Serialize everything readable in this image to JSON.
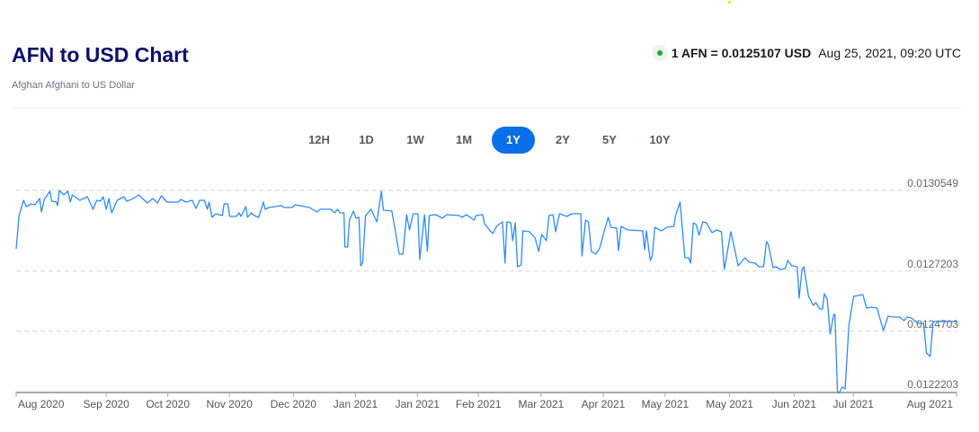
{
  "header": {
    "title": "AFN to USD Chart",
    "subtitle": "Afghan Afghani to US Dollar",
    "rate": "1 AFN = 0.0125107 USD",
    "timestamp": "Aug 25, 2021, 09:20 UTC",
    "live_icon": "green-dot-icon"
  },
  "ranges": [
    {
      "label": "12H",
      "active": false
    },
    {
      "label": "1D",
      "active": false
    },
    {
      "label": "1W",
      "active": false
    },
    {
      "label": "1M",
      "active": false
    },
    {
      "label": "1Y",
      "active": true
    },
    {
      "label": "2Y",
      "active": false
    },
    {
      "label": "5Y",
      "active": false
    },
    {
      "label": "10Y",
      "active": false
    }
  ],
  "colors": {
    "line": "#2f8af5",
    "accent": "#0a6fe8",
    "title": "#0d0f6b",
    "live": "#22a33a"
  },
  "chart_data": {
    "type": "line",
    "title": "AFN to USD Chart",
    "xlabel": "",
    "ylabel": "",
    "xlim": [
      0,
      357.2
    ],
    "ylim": [
      0.0122203,
      0.0130549
    ],
    "grid": true,
    "yticks": [
      {
        "value": 0.0130549,
        "label": "0.0130549"
      },
      {
        "value": 0.0127203,
        "label": "0.0127203"
      },
      {
        "value": 0.0124703,
        "label": "0.0124703"
      },
      {
        "value": 0.0122203,
        "label": "0.0122203"
      }
    ],
    "xticks": [
      {
        "day": 0,
        "label": "Aug 2020"
      },
      {
        "day": 34.2,
        "label": "Sep 2020"
      },
      {
        "day": 57.6,
        "label": "Oct 2020"
      },
      {
        "day": 81.0,
        "label": "Nov 2020"
      },
      {
        "day": 105.3,
        "label": "Dec 2020"
      },
      {
        "day": 128.9,
        "label": "Jan 2021"
      },
      {
        "day": 152.4,
        "label": "Jan 2021"
      },
      {
        "day": 175.6,
        "label": "Feb 2021"
      },
      {
        "day": 199.4,
        "label": "Mar 2021"
      },
      {
        "day": 223.0,
        "label": "Apr 2021"
      },
      {
        "day": 246.5,
        "label": "May 2021"
      },
      {
        "day": 271.0,
        "label": "May 2021"
      },
      {
        "day": 295.5,
        "label": "Jun 2021"
      },
      {
        "day": 318.0,
        "label": "Jul 2021"
      },
      {
        "day": 357.2,
        "label": "Aug 2021"
      }
    ],
    "series": [
      {
        "name": "AFN/USD",
        "points": [
          [
            0,
            0.0128127
          ],
          [
            1.1,
            0.0129506
          ],
          [
            2.8,
            0.0130139
          ],
          [
            3.9,
            0.0129879
          ],
          [
            5.7,
            0.012999
          ],
          [
            7.1,
            0.0129953
          ],
          [
            8.9,
            0.0130214
          ],
          [
            9.6,
            0.0129655
          ],
          [
            10.7,
            0.0130177
          ],
          [
            12.8,
            0.0130512
          ],
          [
            13.5,
            0.0130102
          ],
          [
            15.3,
            0.0130065
          ],
          [
            15.7,
            0.0129916
          ],
          [
            16.4,
            0.0130549
          ],
          [
            18.1,
            0.0130363
          ],
          [
            19.6,
            0.0130512
          ],
          [
            20.6,
            0.0130065
          ],
          [
            21.3,
            0.0130363
          ],
          [
            24.2,
            0.0130139
          ],
          [
            27.0,
            0.0130288
          ],
          [
            29.2,
            0.0129767
          ],
          [
            30.6,
            0.0130139
          ],
          [
            32.0,
            0.0130102
          ],
          [
            33.1,
            0.0130288
          ],
          [
            34.2,
            0.0129767
          ],
          [
            35.2,
            0.0130214
          ],
          [
            36.3,
            0.0129618
          ],
          [
            38.4,
            0.0130139
          ],
          [
            40.9,
            0.0130288
          ],
          [
            42.0,
            0.0130102
          ],
          [
            43.8,
            0.0130177
          ],
          [
            46.6,
            0.0130363
          ],
          [
            49.8,
            0.0130028
          ],
          [
            51.9,
            0.0130214
          ],
          [
            53.7,
            0.0130028
          ],
          [
            55.1,
            0.0130326
          ],
          [
            57.3,
            0.0130065
          ],
          [
            61.5,
            0.0130065
          ],
          [
            62.6,
            0.0130177
          ],
          [
            64.4,
            0.0130065
          ],
          [
            66.9,
            0.0130139
          ],
          [
            68.3,
            0.0129804
          ],
          [
            69.7,
            0.0130139
          ],
          [
            71.5,
            0.0130139
          ],
          [
            72.6,
            0.0129767
          ],
          [
            73.3,
            0.0130065
          ],
          [
            74.4,
            0.0129431
          ],
          [
            75.8,
            0.012958
          ],
          [
            78.3,
            0.0129506
          ],
          [
            79.0,
            0.012999
          ],
          [
            80.4,
            0.012999
          ],
          [
            81.1,
            0.0129469
          ],
          [
            83.6,
            0.0129469
          ],
          [
            84.7,
            0.0129618
          ],
          [
            85.4,
            0.0129469
          ],
          [
            87.2,
            0.0129879
          ],
          [
            87.9,
            0.0129431
          ],
          [
            89.3,
            0.0129618
          ],
          [
            90.4,
            0.0129506
          ],
          [
            92.1,
            0.0129431
          ],
          [
            93.9,
            0.0130065
          ],
          [
            94.6,
            0.0129767
          ],
          [
            96.1,
            0.0129841
          ],
          [
            100.7,
            0.0129916
          ],
          [
            101.7,
            0.0129841
          ],
          [
            104.9,
            0.0129841
          ],
          [
            106.0,
            0.0129953
          ],
          [
            111.4,
            0.0129841
          ],
          [
            114.2,
            0.0129655
          ],
          [
            115.6,
            0.0129767
          ],
          [
            119.5,
            0.0129767
          ],
          [
            121.0,
            0.0129618
          ],
          [
            122.0,
            0.0129767
          ],
          [
            123.1,
            0.0129618
          ],
          [
            124.5,
            0.0129618
          ],
          [
            124.9,
            0.0128202
          ],
          [
            125.9,
            0.0128202
          ],
          [
            126.6,
            0.012932
          ],
          [
            128.1,
            0.0129692
          ],
          [
            129.1,
            0.0129394
          ],
          [
            130.2,
            0.0129431
          ],
          [
            130.9,
            0.0127419
          ],
          [
            131.6,
            0.0127531
          ],
          [
            132.7,
            0.0129506
          ],
          [
            134.8,
            0.0129767
          ],
          [
            137.0,
            0.0129245
          ],
          [
            138.7,
            0.0130512
          ],
          [
            139.5,
            0.012973
          ],
          [
            142.7,
            0.0129692
          ],
          [
            145.5,
            0.0127904
          ],
          [
            146.9,
            0.0127904
          ],
          [
            148.3,
            0.0129543
          ],
          [
            149.4,
            0.012891
          ],
          [
            150.8,
            0.012958
          ],
          [
            152.6,
            0.012958
          ],
          [
            153.3,
            0.012768
          ],
          [
            155.1,
            0.0129543
          ],
          [
            156.2,
            0.0128016
          ],
          [
            156.9,
            0.0129506
          ],
          [
            159.4,
            0.0129543
          ],
          [
            161.9,
            0.0129394
          ],
          [
            163.6,
            0.0129543
          ],
          [
            168.3,
            0.0129506
          ],
          [
            169.3,
            0.0129431
          ],
          [
            171.1,
            0.0129543
          ],
          [
            173.9,
            0.012932
          ],
          [
            174.7,
            0.0129506
          ],
          [
            177.2,
            0.0129543
          ],
          [
            177.9,
            0.0129171
          ],
          [
            180.0,
            0.0128873
          ],
          [
            181.1,
            0.0128761
          ],
          [
            182.5,
            0.0129059
          ],
          [
            184.7,
            0.0129245
          ],
          [
            185.7,
            0.0127531
          ],
          [
            186.4,
            0.0129245
          ],
          [
            187.9,
            0.0129208
          ],
          [
            188.6,
            0.0128463
          ],
          [
            189.6,
            0.0129208
          ],
          [
            190.4,
            0.0127382
          ],
          [
            191.8,
            0.0127457
          ],
          [
            192.5,
            0.0128873
          ],
          [
            195.0,
            0.0128835
          ],
          [
            197.1,
            0.0128574
          ],
          [
            198.5,
            0.0128016
          ],
          [
            199.6,
            0.0128723
          ],
          [
            201.4,
            0.0128463
          ],
          [
            202.4,
            0.0129506
          ],
          [
            203.9,
            0.0129543
          ],
          [
            204.9,
            0.0128835
          ],
          [
            206.4,
            0.012958
          ],
          [
            209.2,
            0.0129469
          ],
          [
            211.0,
            0.012958
          ],
          [
            214.5,
            0.012958
          ],
          [
            214.9,
            0.0127829
          ],
          [
            216.3,
            0.012932
          ],
          [
            217.4,
            0.0129245
          ],
          [
            218.5,
            0.0128016
          ],
          [
            220.2,
            0.0127904
          ],
          [
            221.7,
            0.0128165
          ],
          [
            223.4,
            0.0128873
          ],
          [
            224.9,
            0.0129431
          ],
          [
            225.9,
            0.0129022
          ],
          [
            228.1,
            0.0128984
          ],
          [
            228.8,
            0.0128053
          ],
          [
            229.8,
            0.0129059
          ],
          [
            232.3,
            0.012891
          ],
          [
            238.0,
            0.0128873
          ],
          [
            238.7,
            0.012809
          ],
          [
            239.4,
            0.0128873
          ],
          [
            240.9,
            0.0127643
          ],
          [
            241.6,
            0.0127829
          ],
          [
            242.6,
            0.0129022
          ],
          [
            245.1,
            0.0128873
          ],
          [
            247.3,
            0.0129022
          ],
          [
            249.8,
            0.0129059
          ],
          [
            250.5,
            0.0129506
          ],
          [
            252.2,
            0.0130065
          ],
          [
            254.0,
            0.0127755
          ],
          [
            255.5,
            0.0127755
          ],
          [
            256.2,
            0.0127531
          ],
          [
            257.2,
            0.0129208
          ],
          [
            258.3,
            0.0129133
          ],
          [
            259.4,
            0.0128686
          ],
          [
            260.8,
            0.0129245
          ],
          [
            262.2,
            0.0129208
          ],
          [
            264.3,
            0.0128798
          ],
          [
            266.1,
            0.012891
          ],
          [
            267.9,
            0.0128835
          ],
          [
            269.0,
            0.012727
          ],
          [
            271.5,
            0.0128835
          ],
          [
            274.3,
            0.0127419
          ],
          [
            276.8,
            0.0127755
          ],
          [
            278.6,
            0.0127568
          ],
          [
            280.7,
            0.0127531
          ],
          [
            282.1,
            0.0127382
          ],
          [
            283.9,
            0.0127382
          ],
          [
            285.0,
            0.0128425
          ],
          [
            285.7,
            0.0128314
          ],
          [
            287.5,
            0.0127345
          ],
          [
            288.5,
            0.0127382
          ],
          [
            290.3,
            0.012727
          ],
          [
            292.1,
            0.0127308
          ],
          [
            293.1,
            0.0127643
          ],
          [
            294.6,
            0.0127419
          ],
          [
            296.7,
            0.0127382
          ],
          [
            297.4,
            0.0126078
          ],
          [
            298.5,
            0.012727
          ],
          [
            299.2,
            0.0127382
          ],
          [
            301.0,
            0.0126153
          ],
          [
            302.8,
            0.012578
          ],
          [
            303.8,
            0.0125892
          ],
          [
            305.3,
            0.0125631
          ],
          [
            306.3,
            0.0125631
          ],
          [
            307.0,
            0.0126264
          ],
          [
            308.1,
            0.0126041
          ],
          [
            309.2,
            0.0124588
          ],
          [
            310.6,
            0.0125407
          ],
          [
            311.0,
            0.0125407
          ],
          [
            312.0,
            0.0122166
          ],
          [
            312.7,
            0.0122166
          ],
          [
            313.8,
            0.0122389
          ],
          [
            314.9,
            0.0122315
          ],
          [
            316.3,
            0.0124923
          ],
          [
            318.1,
            0.0126153
          ],
          [
            321.6,
            0.0126227
          ],
          [
            323.0,
            0.0125668
          ],
          [
            324.8,
            0.0125705
          ],
          [
            327.0,
            0.0125668
          ],
          [
            329.4,
            0.0124737
          ],
          [
            331.2,
            0.0125333
          ],
          [
            333.0,
            0.0125296
          ],
          [
            335.5,
            0.0125296
          ],
          [
            337.3,
            0.0125147
          ],
          [
            338.3,
            0.0125296
          ],
          [
            340.1,
            0.0125258
          ],
          [
            341.2,
            0.0125147
          ],
          [
            343.0,
            0.0125035
          ],
          [
            344.7,
            0.0125035
          ],
          [
            345.8,
            0.0123805
          ],
          [
            347.2,
            0.0123656
          ],
          [
            348.3,
            0.0125109
          ],
          [
            357.2,
            0.0125109
          ]
        ]
      }
    ]
  }
}
